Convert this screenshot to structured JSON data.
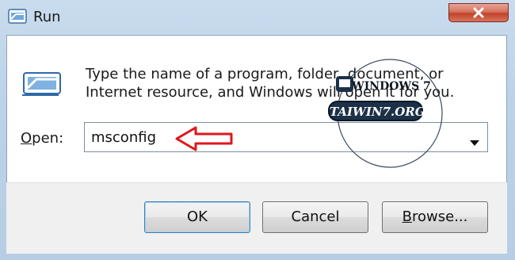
{
  "window": {
    "title": "Run"
  },
  "dialog": {
    "description": "Type the name of a program, folder, document, or Internet resource, and Windows will open it for you.",
    "open_label_first": "O",
    "open_label_rest": "pen:",
    "command_value": "msconfig"
  },
  "buttons": {
    "ok": "OK",
    "cancel": "Cancel",
    "browse_first": "B",
    "browse_rest": "rowse..."
  },
  "watermark": {
    "top_text": "WINDOWS 7",
    "banner_text": "TAIWIN7.ORG"
  },
  "colors": {
    "annotation_arrow": "#e0161c",
    "close_button": "#c0432a"
  },
  "icons": {
    "title": "run-app-icon",
    "dialog": "run-app-icon",
    "close": "close-icon",
    "dropdown": "chevron-down-icon",
    "annotation": "arrow-left-icon"
  }
}
